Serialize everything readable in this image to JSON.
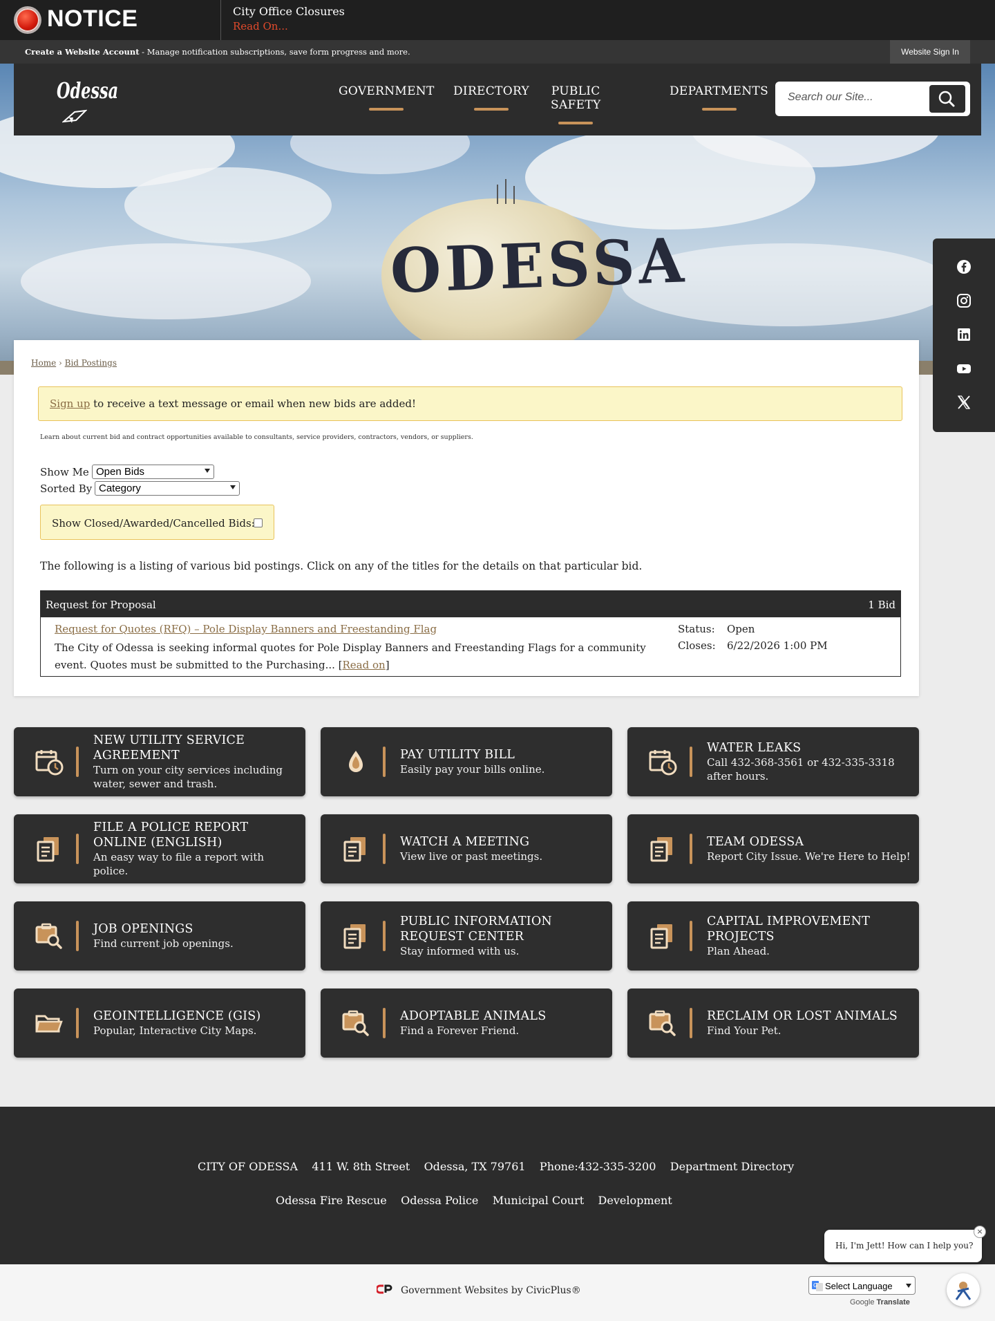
{
  "notice": {
    "title": "NOTICE",
    "text": "City Office Closures",
    "read_on": "Read On..."
  },
  "account_bar": {
    "create_account": "Create a Website Account",
    "description": " - Manage notification subscriptions, save form progress and more.",
    "sign_in": "Website Sign In"
  },
  "header": {
    "logo_text": "Odessa",
    "nav": [
      "GOVERNMENT",
      "DIRECTORY",
      "PUBLIC SAFETY",
      "DEPARTMENTS"
    ],
    "search_placeholder": "Search our Site..."
  },
  "hero": {
    "tower_text": "ODESSA"
  },
  "social": [
    "facebook-icon",
    "instagram-icon",
    "linkedin-icon",
    "youtube-icon",
    "x-twitter-icon"
  ],
  "breadcrumb": {
    "home": "Home",
    "separator": "›",
    "current": "Bid Postings"
  },
  "alert": {
    "link": "Sign up",
    "text": " to receive a text message or email when new bids are added!"
  },
  "intro": "Learn about current bid and contract opportunities available to consultants, service providers, contractors, vendors, or suppliers.",
  "filters": {
    "show_me_label": "Show Me",
    "show_me_value": "Open Bids",
    "sorted_by_label": "Sorted By",
    "sorted_by_value": "Category",
    "show_closed_label": "Show Closed/Awarded/Cancelled Bids:"
  },
  "listing_note": "The following is a listing of various bid postings. Click on any of the titles for the details on that particular bid.",
  "bids": {
    "category": "Request for Proposal",
    "count": "1 Bid",
    "item": {
      "title": "Request for Quotes (RFQ) – Pole Display Banners and Freestanding Flag",
      "description": "The City of Odessa is seeking informal quotes for Pole Display Banners and Freestanding Flags for a community event. Quotes must be submitted to the Purchasing...",
      "read_on": "Read on",
      "status_label": "Status:",
      "status_value": "Open",
      "closes_label": "Closes:",
      "closes_value": "6/22/2026 1:00 PM"
    }
  },
  "quick_links": [
    {
      "title": "New Utility Service Agreement",
      "desc": "Turn on your city services including water, sewer and trash.",
      "icon": "calendar-clock-icon"
    },
    {
      "title": "Pay Utility Bill",
      "desc": "Easily pay your bills online.",
      "icon": "water-drop-icon"
    },
    {
      "title": "Water Leaks",
      "desc": "Call 432-368-3561 or 432-335-3318 after hours.",
      "icon": "calendar-clock-icon"
    },
    {
      "title": "File a Police Report Online (English)",
      "desc": "An easy way to file a report with police.",
      "icon": "documents-icon"
    },
    {
      "title": "Watch a Meeting",
      "desc": "View live or past meetings.",
      "icon": "documents-icon"
    },
    {
      "title": "Team Odessa",
      "desc": "Report City Issue. We're Here to Help!",
      "icon": "documents-icon"
    },
    {
      "title": "Job Openings",
      "desc": "Find current job openings.",
      "icon": "clipboard-search-icon"
    },
    {
      "title": "Public Information Request Center",
      "desc": "Stay informed with us.",
      "icon": "documents-icon"
    },
    {
      "title": "Capital Improvement Projects",
      "desc": "Plan Ahead.",
      "icon": "documents-icon"
    },
    {
      "title": "GeoIntelligence (GIS)",
      "desc": "Popular, Interactive City Maps.",
      "icon": "folder-icon"
    },
    {
      "title": "Adoptable Animals",
      "desc": "Find a Forever Friend.",
      "icon": "clipboard-search-icon"
    },
    {
      "title": "Reclaim or Lost Animals",
      "desc": "Find Your Pet.",
      "icon": "clipboard-search-icon"
    }
  ],
  "footer": {
    "row1": [
      "CITY OF ODESSA",
      "411 W. 8th Street",
      "Odessa, TX 79761",
      "Phone:432-335-3200",
      "Department Directory"
    ],
    "row2": [
      "Odessa Fire Rescue",
      "Odessa Police",
      "Municipal Court",
      "Development"
    ]
  },
  "credit": "Government Websites by CivicPlus®",
  "chat": {
    "text": "Hi, I'm Jett! How can I help you?",
    "close": "×"
  },
  "language": {
    "select": "Select Language",
    "powered_prefix": "Google",
    "powered": "Translate"
  },
  "colors": {
    "accent": "#c8935a",
    "dark": "#2c2c2c",
    "alert_bg": "#fbf6c8",
    "notice_red": "#e04a2c",
    "link_brown": "#8a6d45"
  }
}
